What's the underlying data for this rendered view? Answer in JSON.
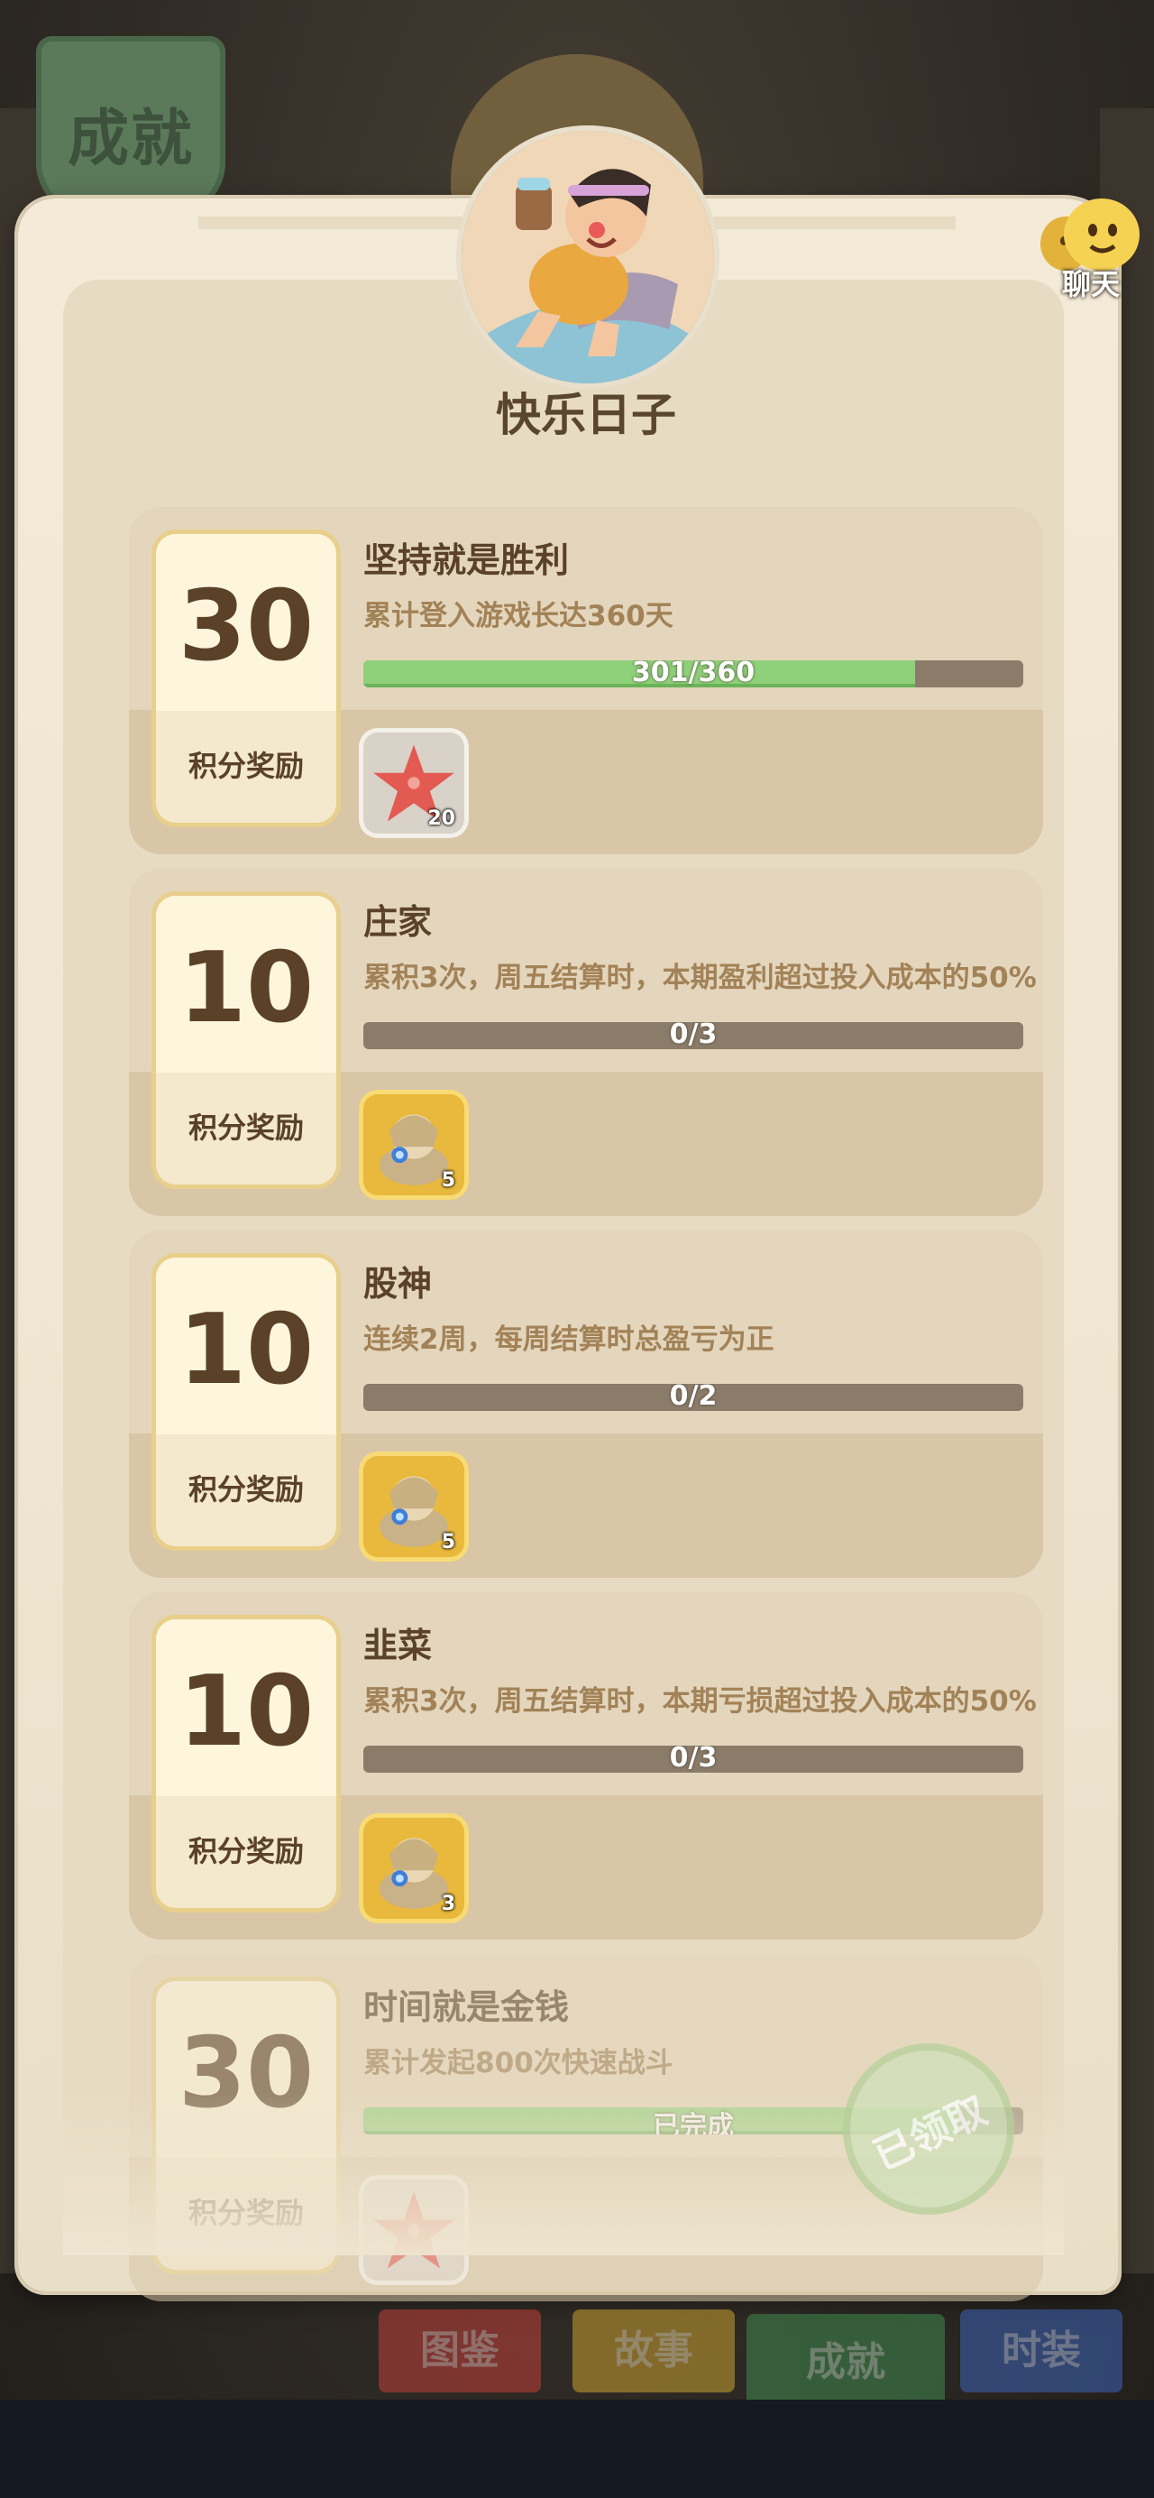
{
  "page": {
    "banner_title": "成就"
  },
  "header": {
    "avatar_title": "快乐日子",
    "chat_label": "聊天"
  },
  "achievements": [
    {
      "points": "30",
      "points_label": "积分奖励",
      "title": "坚持就是胜利",
      "desc": "累计登入游戏长达360天",
      "progress_text": "301/360",
      "progress": 0.836,
      "reward_icon": "starfish-icon",
      "reward_count": "20"
    },
    {
      "points": "10",
      "points_label": "积分奖励",
      "title": "庄家",
      "desc": "累积3次，周五结算时，本期盈利超过投入成本的50%",
      "progress_text": "0/3",
      "progress": 0,
      "reward_icon": "sphinx-icon",
      "reward_count": "5"
    },
    {
      "points": "10",
      "points_label": "积分奖励",
      "title": "股神",
      "desc": "连续2周，每周结算时总盈亏为正",
      "progress_text": "0/2",
      "progress": 0,
      "reward_icon": "sphinx-icon",
      "reward_count": "5"
    },
    {
      "points": "10",
      "points_label": "积分奖励",
      "title": "韭菜",
      "desc": "累积3次，周五结算时，本期亏损超过投入成本的50%",
      "progress_text": "0/3",
      "progress": 0,
      "reward_icon": "sphinx-icon",
      "reward_count": "3"
    },
    {
      "points": "30",
      "points_label": "积分奖励",
      "title": "时间就是金钱",
      "desc": "累计发起800次快速战斗",
      "progress_text": "已完成",
      "progress": 0.9,
      "reward_icon": "starfish-icon",
      "claimed_label": "已领取"
    }
  ],
  "tabs": [
    {
      "label": "图鉴",
      "color": "#c0403a"
    },
    {
      "label": "故事",
      "color": "#c9a032"
    },
    {
      "label": "成就",
      "color": "#3f8a4f"
    },
    {
      "label": "时装",
      "color": "#3e64b8"
    }
  ],
  "colors": {
    "accent_green": "#8fd07a",
    "text_brown": "#5a4128",
    "parchment": "#efe5d0"
  }
}
